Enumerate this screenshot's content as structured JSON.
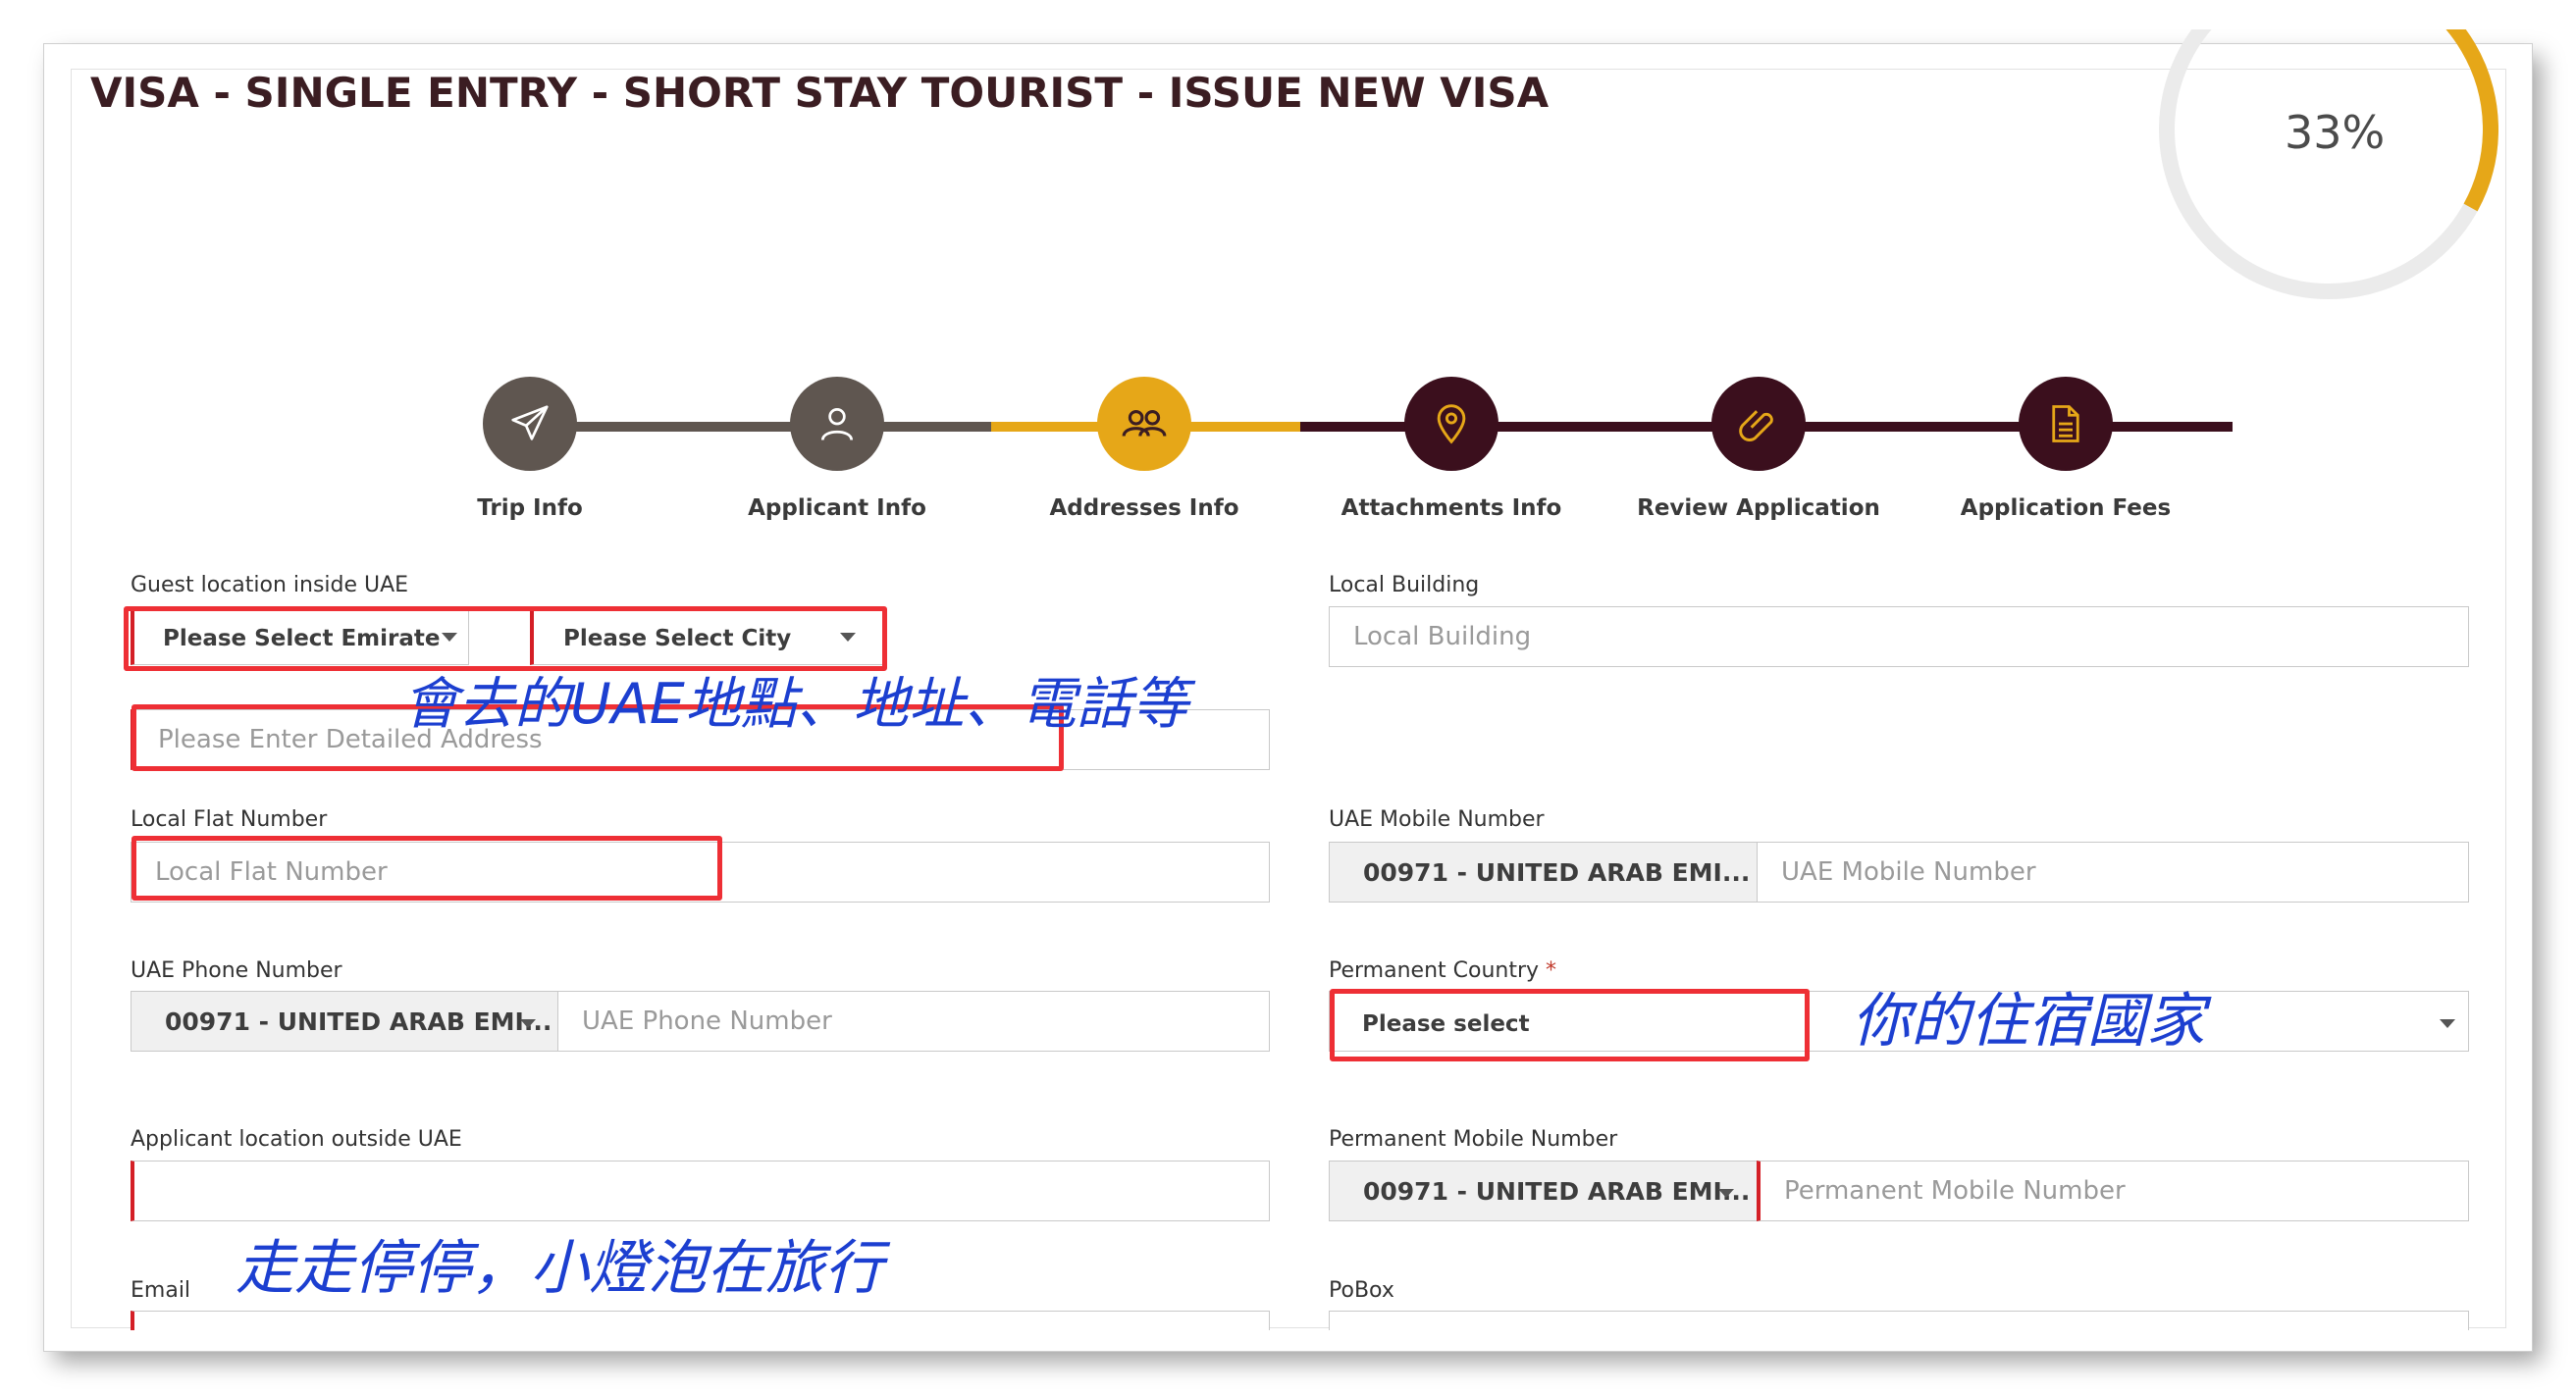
{
  "header": {
    "title": "VISA - SINGLE ENTRY - SHORT STAY TOURIST - ISSUE NEW VISA",
    "progress_label": "33%",
    "progress_fraction": 0.33,
    "progress_color": "#e6a718"
  },
  "steps": [
    {
      "label": "Trip Info",
      "icon": "airplane-icon",
      "state": "done",
      "color": "#5f5650"
    },
    {
      "label": "Applicant Info",
      "icon": "person-icon",
      "state": "done",
      "color": "#5f5650"
    },
    {
      "label": "Addresses Info",
      "icon": "group-icon",
      "state": "current",
      "color": "#e6a718"
    },
    {
      "label": "Attachments Info",
      "icon": "location-pin-icon",
      "state": "pending",
      "color": "#3b0f1d"
    },
    {
      "label": "Review Application",
      "icon": "paperclip-icon",
      "state": "pending",
      "color": "#3b0f1d"
    },
    {
      "label": "Application Fees",
      "icon": "document-icon",
      "state": "pending",
      "color": "#3b0f1d"
    }
  ],
  "form": {
    "guest_location": {
      "label": "Guest location inside UAE",
      "emirate_placeholder": "Please Select Emirate",
      "city_placeholder": "Please Select City",
      "address_placeholder": "Please Enter Detailed Address"
    },
    "local_building": {
      "label": "Local Building",
      "placeholder": "Local Building"
    },
    "local_flat": {
      "label": "Local Flat Number",
      "placeholder": "Local Flat Number"
    },
    "uae_mobile": {
      "label": "UAE Mobile Number",
      "code": "00971 - UNITED ARAB EMI...",
      "placeholder": "UAE Mobile Number"
    },
    "uae_phone": {
      "label": "UAE Phone Number",
      "code": "00971 - UNITED ARAB EMI...",
      "placeholder": "UAE Phone Number"
    },
    "permanent_country": {
      "label": "Permanent Country",
      "required_mark": "*",
      "placeholder": "Please select"
    },
    "applicant_location_outside": {
      "label": "Applicant location outside UAE"
    },
    "permanent_mobile": {
      "label": "Permanent Mobile Number",
      "code": "00971 - UNITED ARAB EMI...",
      "placeholder": "Permanent Mobile Number"
    },
    "email": {
      "label": "Email"
    },
    "pobox": {
      "label": "PoBox"
    }
  },
  "annotations": {
    "note_uae_address": "會去的UAE地點、地址、電話等",
    "note_country": "你的住宿國家",
    "watermark": "走走停停，小燈泡在旅行",
    "ink_color": "#1c3fd0",
    "box_color": "#ee2f35"
  }
}
